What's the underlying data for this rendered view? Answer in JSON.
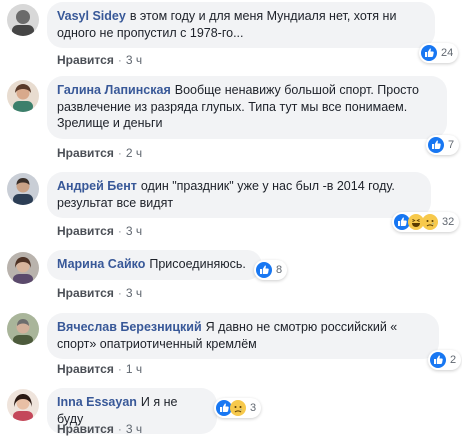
{
  "actions": {
    "like_label": "Нравится",
    "dot": "·"
  },
  "comments": [
    {
      "author": "Vasyl Sidey",
      "text": "в этом году и для меня Мундиаля нет, хотя ни одного не пропустил с 1978-го...",
      "time": "3 ч",
      "reaction_count": "24",
      "reaction_icons": [
        "like-icon"
      ]
    },
    {
      "author": "Галина Лапинская",
      "text": "Вообще ненавижу большой спорт. Просто развлечение из разряда глупых. Типа тут мы все понимаем. Зрелище и деньги",
      "time": "2 ч",
      "reaction_count": "7",
      "reaction_icons": [
        "like-icon"
      ]
    },
    {
      "author": "Андрей Бент",
      "text": "один \"праздник\" уже у нас был -в 2014 году. результат все видят",
      "time": "3 ч",
      "reaction_count": "32",
      "reaction_icons": [
        "like-icon",
        "haha-icon",
        "sad-icon"
      ]
    },
    {
      "author": "Марина Сайко",
      "text": "Присоединяюсь.",
      "time": "3 ч",
      "reaction_count": "8",
      "reaction_icons": [
        "like-icon"
      ]
    },
    {
      "author": "Вячеслав Березницкий",
      "text": "Я давно не смотрю российский « спорт» опатриотиченный кремлём",
      "time": "1 ч",
      "reaction_count": "2",
      "reaction_icons": [
        "like-icon"
      ]
    },
    {
      "author": "Inna Essayan",
      "text": "И я не буду",
      "time": "3 ч",
      "reaction_count": "3",
      "reaction_icons": [
        "like-icon",
        "sad-icon"
      ]
    }
  ],
  "colors": {
    "author": "#385898",
    "bubble_bg": "#f2f3f5",
    "like_blue": "#1877f2",
    "emoji_yellow": "#f7c94c"
  }
}
